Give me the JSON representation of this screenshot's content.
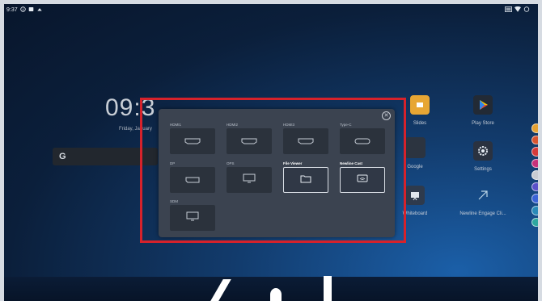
{
  "status_bar": {
    "time": "9:37"
  },
  "home": {
    "clock": "09:3",
    "date": "Friday, January",
    "apps": [
      {
        "label": "Slides"
      },
      {
        "label": "Play Store"
      },
      {
        "label": "Google"
      },
      {
        "label": "Settings"
      },
      {
        "label": "Whiteboard"
      },
      {
        "label": "Newline Engage Cli..."
      }
    ]
  },
  "source_dialog": {
    "sources": [
      {
        "label": "HDMI1",
        "icon": "hdmi-port-icon"
      },
      {
        "label": "HDMI2",
        "icon": "hdmi-port-icon"
      },
      {
        "label": "HDMI3",
        "icon": "hdmi-port-icon"
      },
      {
        "label": "Type-C",
        "icon": "usb-c-port-icon"
      },
      {
        "label": "DP",
        "icon": "displayport-icon"
      },
      {
        "label": "OPS",
        "icon": "ops-icon"
      },
      {
        "label": "File Viewer",
        "icon": "folder-icon"
      },
      {
        "label": "Newline Cast",
        "icon": "cast-icon"
      },
      {
        "label": "SDM",
        "icon": "sdm-icon"
      }
    ]
  },
  "colors": {
    "highlight": "#d6222b",
    "dialog_bg": "#3b4350",
    "tile_bg": "#2b323c"
  }
}
